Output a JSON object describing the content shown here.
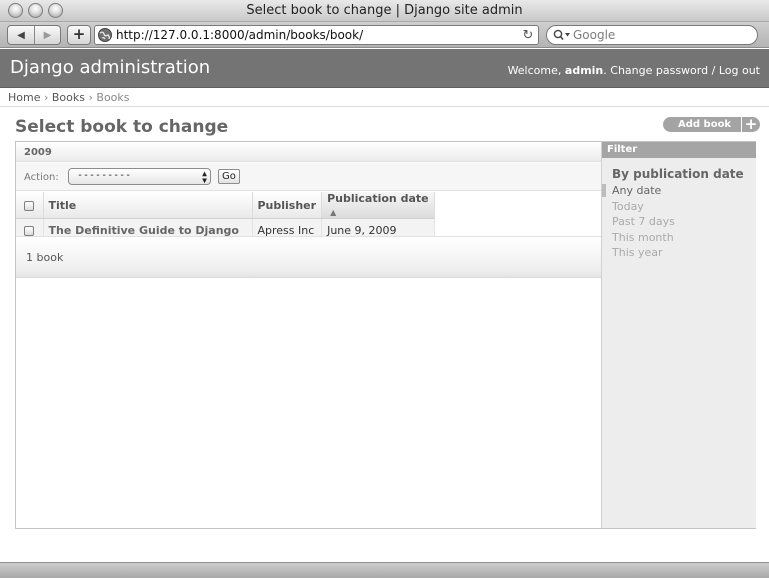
{
  "window": {
    "title": "Select book to change | Django site admin"
  },
  "browser": {
    "url": "http://127.0.0.1:8000/admin/books/book/",
    "search_placeholder": "Google",
    "nav": {
      "back": "◀",
      "forward": "▶",
      "add": "+",
      "reload": "↻"
    }
  },
  "header": {
    "branding": "Django administration",
    "welcome": "Welcome,",
    "username": "admin",
    "change_password": "Change password",
    "separator": "/",
    "logout": "Log out"
  },
  "breadcrumbs": {
    "items": [
      "Home",
      "Books",
      "Books"
    ],
    "separator": "›"
  },
  "page": {
    "title": "Select book to change",
    "add_button": "Add book",
    "add_icon": "+"
  },
  "date_hierarchy": "2009",
  "actions": {
    "label": "Action:",
    "selected": "---------",
    "go": "Go"
  },
  "table": {
    "columns": [
      "Title",
      "Publisher",
      "Publication date"
    ],
    "sorted_column": "Publication date",
    "sort_arrow": "▲",
    "rows": [
      {
        "title": "The Definitive Guide to Django",
        "publisher": "Apress Inc",
        "publication_date": "June 9, 2009"
      }
    ]
  },
  "paginator": "1 book",
  "filter": {
    "title": "Filter",
    "heading": "By publication date",
    "options": [
      "Any date",
      "Today",
      "Past 7 days",
      "This month",
      "This year"
    ],
    "selected": "Any date"
  },
  "colors": {
    "header_bg": "#747474",
    "filter_title_bg": "#a5a5a5"
  },
  "icons": [
    "globe-icon",
    "search-icon",
    "reload-icon",
    "back-arrow-icon",
    "forward-arrow-icon",
    "plus-icon",
    "sort-ascending-icon",
    "select-arrows-icon",
    "checkbox-icon"
  ]
}
